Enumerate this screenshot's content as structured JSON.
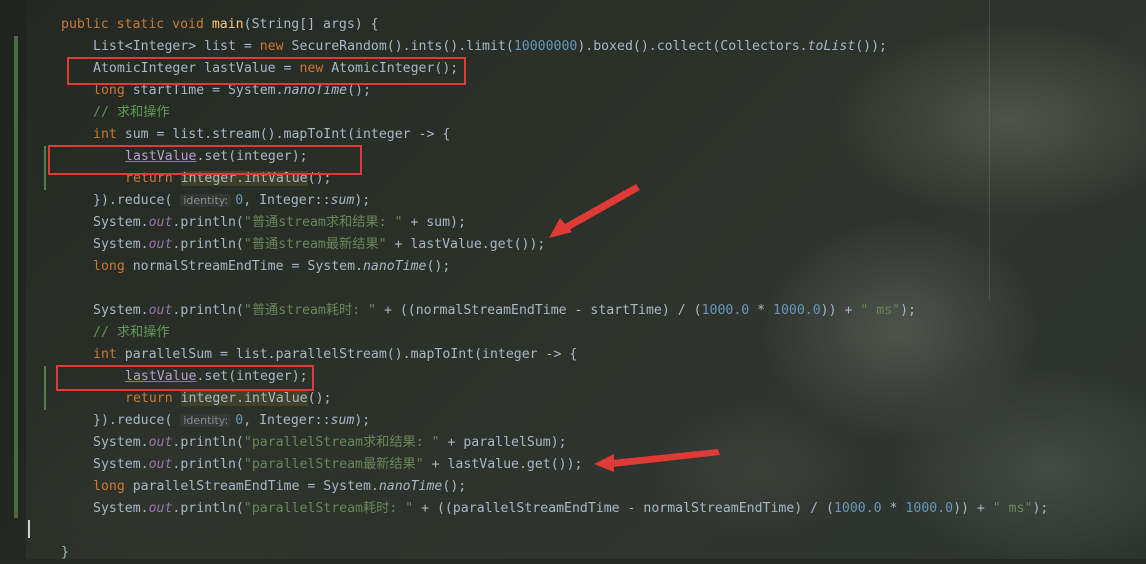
{
  "code_lines": [
    [
      [
        "kw",
        "public static void "
      ],
      [
        "fn",
        "main"
      ],
      [
        "t",
        "(String[] args) {"
      ]
    ],
    [
      [
        "t",
        "List<Integer> list = "
      ],
      [
        "kw",
        "new "
      ],
      [
        "t",
        "SecureRandom().ints().limit("
      ],
      [
        "num",
        "10000000"
      ],
      [
        "t",
        ").boxed().collect(Collectors."
      ],
      [
        "it",
        "toList"
      ],
      [
        "t",
        "());"
      ]
    ],
    [
      [
        "t",
        "AtomicInteger lastValue = "
      ],
      [
        "kw",
        "new "
      ],
      [
        "t",
        "AtomicInteger();"
      ]
    ],
    [
      [
        "kw",
        "long "
      ],
      [
        "t",
        "startTime = System."
      ],
      [
        "it",
        "nanoTime"
      ],
      [
        "t",
        "();"
      ]
    ],
    [
      [
        "cm",
        "// 求和操作"
      ]
    ],
    [
      [
        "kw",
        "int "
      ],
      [
        "t",
        "sum = list.stream().mapToInt(integer -> {"
      ]
    ],
    [
      [
        "field",
        "lastValue"
      ],
      [
        "t",
        ".set(integer);"
      ]
    ],
    [
      [
        "kw",
        "return "
      ],
      [
        "hl",
        "integer.intValue"
      ],
      [
        "t",
        "();"
      ]
    ],
    [
      [
        "t",
        "}).reduce( "
      ],
      [
        "hint",
        "identity:"
      ],
      [
        "num",
        "0"
      ],
      [
        "t",
        ", Integer::"
      ],
      [
        "it",
        "sum"
      ],
      [
        "t",
        ");"
      ]
    ],
    [
      [
        "t",
        "System."
      ],
      [
        "st",
        "out"
      ],
      [
        "t",
        ".println("
      ],
      [
        "str",
        "\"普通stream求和结果: \""
      ],
      [
        "t",
        " + sum);"
      ]
    ],
    [
      [
        "t",
        "System."
      ],
      [
        "st",
        "out"
      ],
      [
        "t",
        ".println("
      ],
      [
        "str",
        "\"普通stream最新结果\""
      ],
      [
        "t",
        " + lastValue.get());"
      ]
    ],
    [
      [
        "kw",
        "long "
      ],
      [
        "t",
        "normalStreamEndTime = System."
      ],
      [
        "it",
        "nanoTime"
      ],
      [
        "t",
        "();"
      ]
    ],
    [],
    [
      [
        "t",
        "System."
      ],
      [
        "st",
        "out"
      ],
      [
        "t",
        ".println("
      ],
      [
        "str",
        "\"普通stream耗时: \""
      ],
      [
        "t",
        " + ((normalStreamEndTime - startTime) / ("
      ],
      [
        "num",
        "1000.0"
      ],
      [
        "t",
        " * "
      ],
      [
        "num",
        "1000.0"
      ],
      [
        "t",
        ")) + "
      ],
      [
        "str",
        "\" ms\""
      ],
      [
        "t",
        ");"
      ]
    ],
    [
      [
        "cm",
        "// 求和操作"
      ]
    ],
    [
      [
        "kw",
        "int "
      ],
      [
        "t",
        "parallelSum = list.parallelStream().mapToInt(integer -> {"
      ]
    ],
    [
      [
        "field",
        "lastValue"
      ],
      [
        "t",
        ".set(integer);"
      ]
    ],
    [
      [
        "kw",
        "return "
      ],
      [
        "hl",
        "integer.intValue"
      ],
      [
        "t",
        "();"
      ]
    ],
    [
      [
        "t",
        "}).reduce( "
      ],
      [
        "hint",
        "identity:"
      ],
      [
        "num",
        "0"
      ],
      [
        "t",
        ", Integer::"
      ],
      [
        "it",
        "sum"
      ],
      [
        "t",
        ");"
      ]
    ],
    [
      [
        "t",
        "System."
      ],
      [
        "st",
        "out"
      ],
      [
        "t",
        ".println("
      ],
      [
        "str",
        "\"parallelStream求和结果: \""
      ],
      [
        "t",
        " + parallelSum);"
      ]
    ],
    [
      [
        "t",
        "System."
      ],
      [
        "st",
        "out"
      ],
      [
        "t",
        ".println("
      ],
      [
        "str",
        "\"parallelStream最新结果\""
      ],
      [
        "t",
        " + lastValue.get());"
      ]
    ],
    [
      [
        "kw",
        "long "
      ],
      [
        "t",
        "parallelStreamEndTime = System."
      ],
      [
        "it",
        "nanoTime"
      ],
      [
        "t",
        "();"
      ]
    ],
    [
      [
        "t",
        "System."
      ],
      [
        "st",
        "out"
      ],
      [
        "t",
        ".println("
      ],
      [
        "str",
        "\"parallelStream耗时: \""
      ],
      [
        "t",
        " + ((parallelStreamEndTime - normalStreamEndTime) / ("
      ],
      [
        "num",
        "1000.0"
      ],
      [
        "t",
        " * "
      ],
      [
        "num",
        "1000.0"
      ],
      [
        "t",
        ")) + "
      ],
      [
        "str",
        "\" ms\""
      ],
      [
        "t",
        ");"
      ]
    ],
    [],
    [
      [
        "t",
        "}"
      ]
    ]
  ],
  "colors": {
    "keyword": "#cc7832",
    "function": "#ffc66d",
    "string": "#6a8759",
    "number": "#6897bb",
    "comment": "#629755",
    "static_field": "#9876aa",
    "annotation_red": "#e03a36"
  },
  "annotations": {
    "red_boxes": 3,
    "red_arrows": 2
  }
}
